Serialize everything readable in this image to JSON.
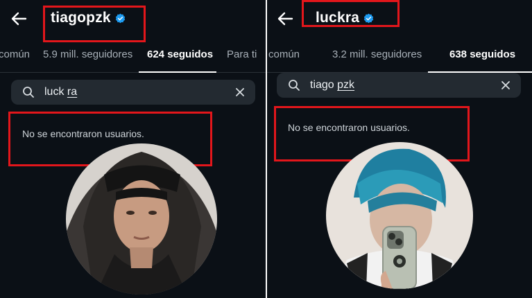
{
  "left": {
    "username": "tiagopzk",
    "tabs": {
      "in_common": "común",
      "followers": "5.9 mill. seguidores",
      "following": "624 seguidos",
      "for_you": "Para ti"
    },
    "search": {
      "value_a": "luck ",
      "value_b": "ra"
    },
    "empty_message": "No se encontraron usuarios."
  },
  "right": {
    "username": "luckra",
    "tabs": {
      "in_common": "común",
      "followers": "3.2 mill. seguidores",
      "following": "638 seguidos"
    },
    "search": {
      "value_a": "tiago ",
      "value_b": "pzk"
    },
    "empty_message": "No se encontraron usuarios."
  },
  "icons": {
    "back": "arrow-left-icon",
    "verified": "verified-badge-icon",
    "search": "search-icon",
    "clear": "close-icon"
  },
  "colors": {
    "background": "#0b1016",
    "highlight": "#e3161b",
    "verified": "#1d9bf0",
    "search_bg": "#232a31"
  }
}
